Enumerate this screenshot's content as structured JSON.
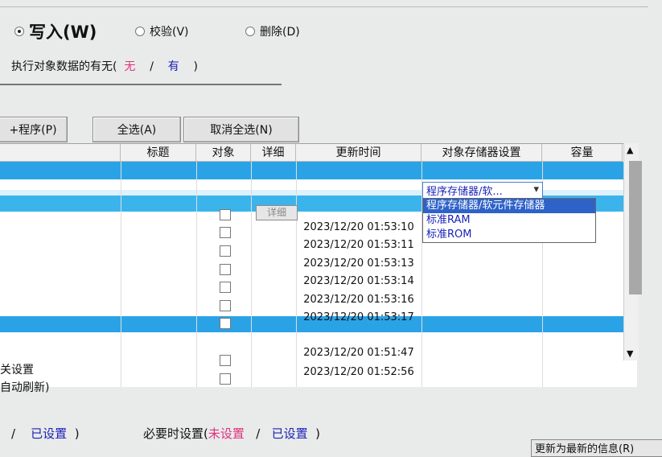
{
  "modes": {
    "write": "写入(W)",
    "verify": "校验(V)",
    "delete": "删除(D)"
  },
  "existence": {
    "label": "执行对象数据的有无(",
    "none": "无",
    "slash": "/",
    "has": "有",
    "close": ")"
  },
  "buttons": {
    "program": "+程序(P)",
    "select_all": "全选(A)",
    "deselect_all": "取消全选(N)"
  },
  "table": {
    "headers": [
      "标题",
      "对象",
      "详细",
      "更新时间",
      "对象存储器设置",
      "容量"
    ],
    "detail_label": "详细",
    "timestamps": [
      "2023/12/20 01:53:10",
      "2023/12/20 01:53:11",
      "2023/12/20 01:53:13",
      "2023/12/20 01:53:14",
      "2023/12/20 01:53:16",
      "2023/12/20 01:53:17",
      "2023/12/20 01:51:47",
      "2023/12/20 01:52:56"
    ],
    "left_labels": [
      "关设置",
      "自动刷新)"
    ]
  },
  "memory": {
    "selected": "程序存储器/软...",
    "options": [
      "程序存储器/软元件存储器",
      "标准RAM",
      "标准ROM"
    ]
  },
  "footer": {
    "left_slash": "/",
    "left_set": "已设置",
    "left_close": ")",
    "needed_label": "必要时设置(",
    "not_set": "未设置",
    "slash": "/",
    "set": "已设置",
    "close": ")",
    "update_button": "更新为最新的信息(R)"
  },
  "colors": {
    "selection": "#2aa3e6",
    "pink": "#e0327f",
    "blue": "#1a22b8"
  }
}
